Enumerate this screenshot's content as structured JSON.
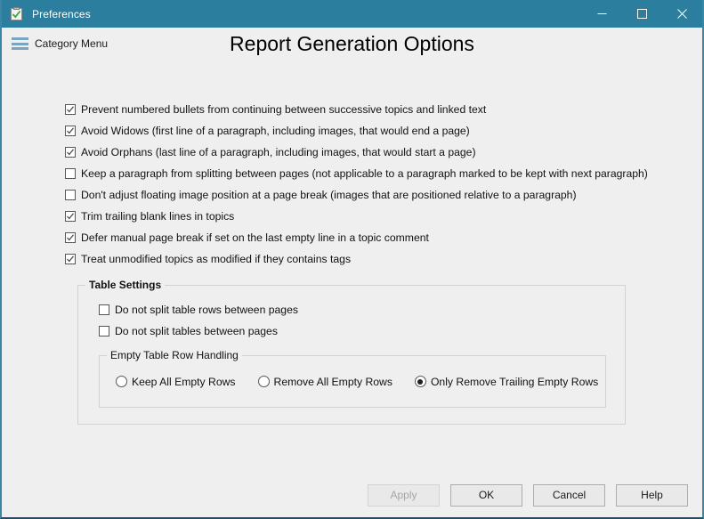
{
  "window": {
    "title": "Preferences",
    "icon": "clipboard-check-icon",
    "titlebar_color": "#2b7e9e",
    "controls": {
      "minimize": "minimize-icon",
      "maximize": "maximize-icon",
      "close": "close-icon"
    }
  },
  "header": {
    "category_menu_label": "Category Menu",
    "category_menu_icon": "hamburger-icon",
    "page_title": "Report Generation Options"
  },
  "options": [
    {
      "label": "Prevent numbered bullets from continuing between successive topics and linked text",
      "checked": true
    },
    {
      "label": "Avoid Widows (first line of a paragraph, including images, that would end a page)",
      "checked": true
    },
    {
      "label": "Avoid Orphans (last line of a paragraph, including images, that would start a page)",
      "checked": true
    },
    {
      "label": "Keep a paragraph from splitting between pages (not applicable to a paragraph marked to be kept with next paragraph)",
      "checked": false
    },
    {
      "label": "Don't adjust floating image position at a page break (images that are positioned relative to a paragraph)",
      "checked": false
    },
    {
      "label": "Trim trailing blank lines in topics",
      "checked": true
    },
    {
      "label": "Defer manual page break if set on the last empty line in a topic comment",
      "checked": true
    },
    {
      "label": "Treat unmodified topics as modified if they contains tags",
      "checked": true
    }
  ],
  "table_settings": {
    "title": "Table Settings",
    "options": [
      {
        "label": "Do not split table rows between pages",
        "checked": false
      },
      {
        "label": "Do not split tables between pages",
        "checked": false
      }
    ],
    "empty_row_handling": {
      "title": "Empty Table Row Handling",
      "options": [
        {
          "label": "Keep All Empty Rows",
          "selected": false
        },
        {
          "label": "Remove All Empty Rows",
          "selected": false
        },
        {
          "label": "Only Remove Trailing Empty Rows",
          "selected": true
        }
      ]
    }
  },
  "footer": {
    "buttons": [
      {
        "label": "Apply",
        "enabled": false
      },
      {
        "label": "OK",
        "enabled": true
      },
      {
        "label": "Cancel",
        "enabled": true
      },
      {
        "label": "Help",
        "enabled": true
      }
    ]
  }
}
